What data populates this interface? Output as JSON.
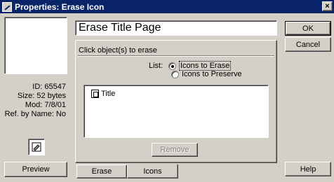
{
  "window": {
    "title": "Properties: Erase Icon",
    "close_glyph": "×"
  },
  "left_panel": {
    "id_line": "ID: 65547",
    "size_line": "Size: 52 bytes",
    "mod_line": "Mod: 7/8/01",
    "ref_line": "Ref. by Name: No",
    "preview_label": "Preview"
  },
  "name_field": {
    "value": "Erase Title Page"
  },
  "panel": {
    "header": "Click object(s) to erase",
    "list_label": "List:",
    "radio_erase": "Icons to Erase",
    "radio_preserve": "Icons to Preserve",
    "selected_radio": "Icons to Erase",
    "items": [
      {
        "label": "Title"
      }
    ],
    "remove_label": "Remove"
  },
  "tabs": [
    {
      "label": "Erase",
      "active": false
    },
    {
      "label": "Icons",
      "active": true
    }
  ],
  "buttons": {
    "ok": "OK",
    "cancel": "Cancel",
    "help": "Help"
  }
}
